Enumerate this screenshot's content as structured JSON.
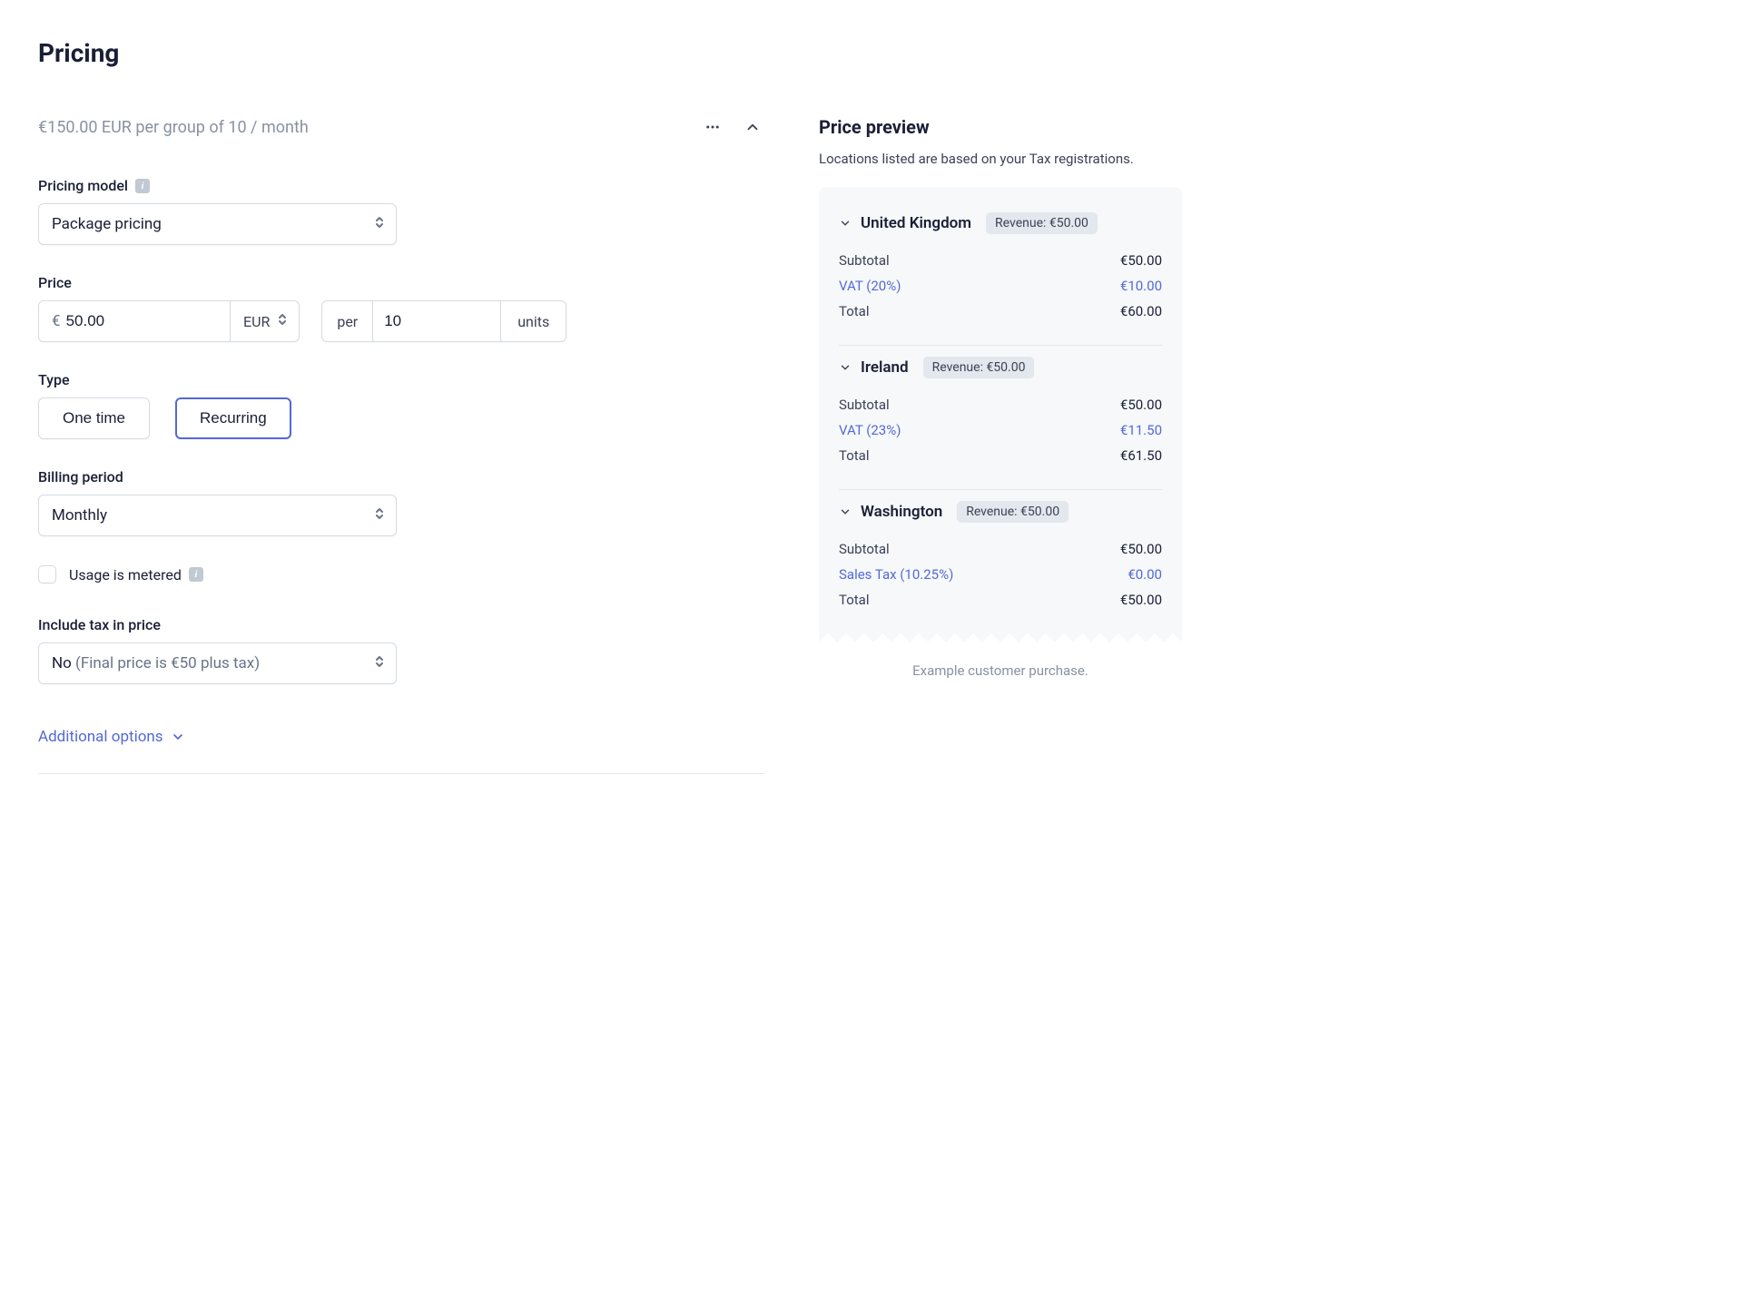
{
  "page_title": "Pricing",
  "summary": "€150.00 EUR per group of 10 / month",
  "pricing_model": {
    "label": "Pricing model",
    "value": "Package pricing"
  },
  "price": {
    "label": "Price",
    "currency_symbol": "€",
    "amount": "50.00",
    "currency": "EUR",
    "per_label": "per",
    "per_quantity": "10",
    "units_label": "units"
  },
  "type": {
    "label": "Type",
    "one_time": "One time",
    "recurring": "Recurring"
  },
  "billing_period": {
    "label": "Billing period",
    "value": "Monthly"
  },
  "metered": {
    "label": "Usage is metered"
  },
  "include_tax": {
    "label": "Include tax in price",
    "value_prefix": "No",
    "value_detail": " (Final price is €50 plus tax)"
  },
  "additional_options": "Additional options",
  "preview": {
    "title": "Price preview",
    "subtitle": "Locations listed are based on your Tax registrations.",
    "example_note": "Example customer purchase.",
    "revenue_label": "Revenue:",
    "regions": [
      {
        "name": "United Kingdom",
        "revenue": "€50.00",
        "subtotal_label": "Subtotal",
        "subtotal": "€50.00",
        "tax_label": "VAT (20%)",
        "tax": "€10.00",
        "total_label": "Total",
        "total": "€60.00"
      },
      {
        "name": "Ireland",
        "revenue": "€50.00",
        "subtotal_label": "Subtotal",
        "subtotal": "€50.00",
        "tax_label": "VAT (23%)",
        "tax": "€11.50",
        "total_label": "Total",
        "total": "€61.50"
      },
      {
        "name": "Washington",
        "revenue": "€50.00",
        "subtotal_label": "Subtotal",
        "subtotal": "€50.00",
        "tax_label": "Sales Tax (10.25%)",
        "tax": "€0.00",
        "total_label": "Total",
        "total": "€50.00"
      }
    ]
  }
}
